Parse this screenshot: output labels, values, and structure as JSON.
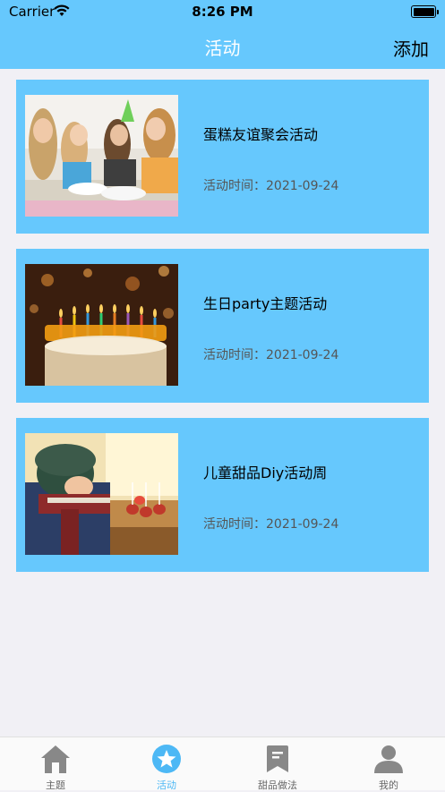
{
  "status": {
    "carrier": "Carrier",
    "time": "8:26 PM"
  },
  "nav": {
    "title": "活动",
    "add_label": "添加"
  },
  "activities": [
    {
      "title": "蛋糕友谊聚会活动",
      "time": "活动时间：2021-09-24"
    },
    {
      "title": "生日party主题活动",
      "time": "活动时间：2021-09-24"
    },
    {
      "title": "儿童甜品Diy活动周",
      "time": "活动时间：2021-09-24"
    }
  ],
  "tabs": [
    {
      "label": "主题",
      "icon": "home-icon"
    },
    {
      "label": "活动",
      "icon": "star-icon",
      "active": true
    },
    {
      "label": "甜品做法",
      "icon": "bookmark-icon"
    },
    {
      "label": "我的",
      "icon": "person-icon"
    }
  ],
  "colors": {
    "accent": "#66c8fd",
    "background": "#f1f0f5",
    "tab_active": "#4db8f5"
  }
}
